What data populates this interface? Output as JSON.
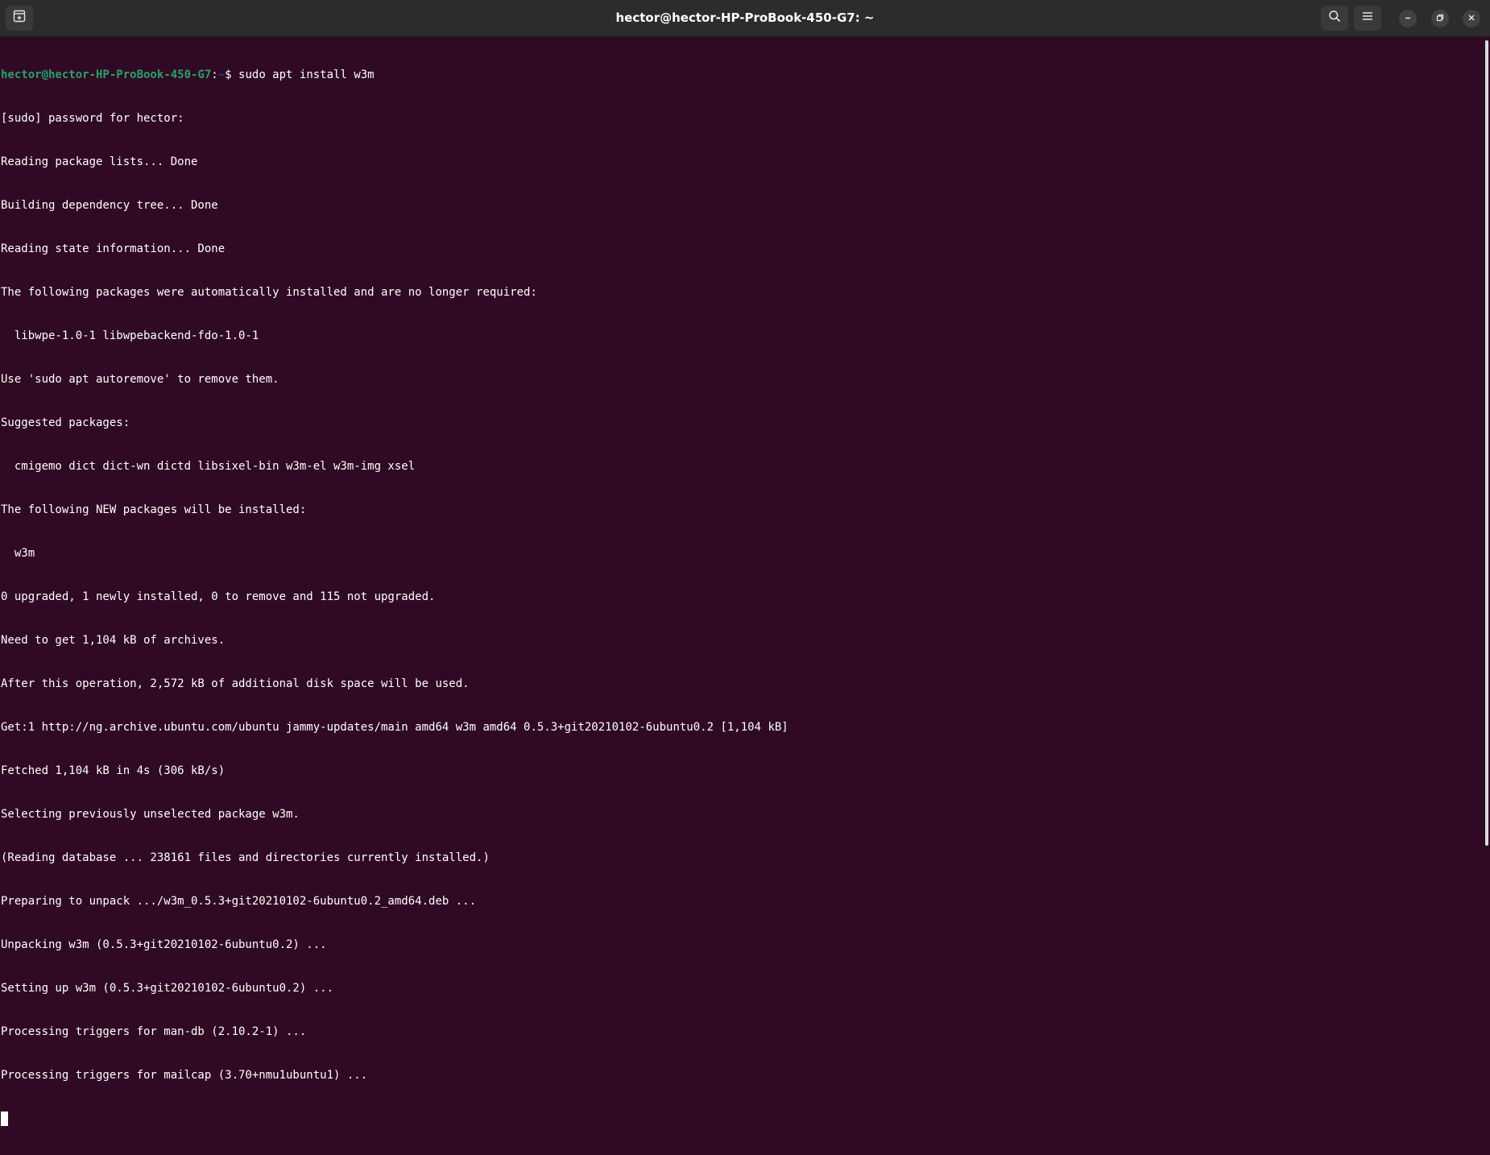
{
  "window": {
    "title": "hector@hector-HP-ProBook-450-G7: ~"
  },
  "header_buttons": {
    "new_tab_icon": "new-tab-icon",
    "search_icon": "search-icon",
    "menu_icon": "hamburger-menu-icon",
    "minimize_icon": "minimize-icon",
    "restore_icon": "restore-icon",
    "close_icon": "close-icon"
  },
  "colors": {
    "terminal_bg": "#300a24",
    "titlebar_bg": "#2c2c2c",
    "prompt_user": "#26a269",
    "prompt_path": "#12488b",
    "text": "#ffffff"
  },
  "prompt": {
    "user_host": "hector@hector-HP-ProBook-450-G7",
    "sep": ":",
    "path": "~",
    "symbol": "$ ",
    "command": "sudo apt install w3m"
  },
  "output_lines": [
    "[sudo] password for hector:",
    "Reading package lists... Done",
    "Building dependency tree... Done",
    "Reading state information... Done",
    "The following packages were automatically installed and are no longer required:",
    "  libwpe-1.0-1 libwpebackend-fdo-1.0-1",
    "Use 'sudo apt autoremove' to remove them.",
    "Suggested packages:",
    "  cmigemo dict dict-wn dictd libsixel-bin w3m-el w3m-img xsel",
    "The following NEW packages will be installed:",
    "  w3m",
    "0 upgraded, 1 newly installed, 0 to remove and 115 not upgraded.",
    "Need to get 1,104 kB of archives.",
    "After this operation, 2,572 kB of additional disk space will be used.",
    "Get:1 http://ng.archive.ubuntu.com/ubuntu jammy-updates/main amd64 w3m amd64 0.5.3+git20210102-6ubuntu0.2 [1,104 kB]",
    "Fetched 1,104 kB in 4s (306 kB/s)",
    "Selecting previously unselected package w3m.",
    "(Reading database ... 238161 files and directories currently installed.)",
    "Preparing to unpack .../w3m_0.5.3+git20210102-6ubuntu0.2_amd64.deb ...",
    "Unpacking w3m (0.5.3+git20210102-6ubuntu0.2) ...",
    "Setting up w3m (0.5.3+git20210102-6ubuntu0.2) ...",
    "Processing triggers for man-db (2.10.2-1) ...",
    "Processing triggers for mailcap (3.70+nmu1ubuntu1) ..."
  ]
}
